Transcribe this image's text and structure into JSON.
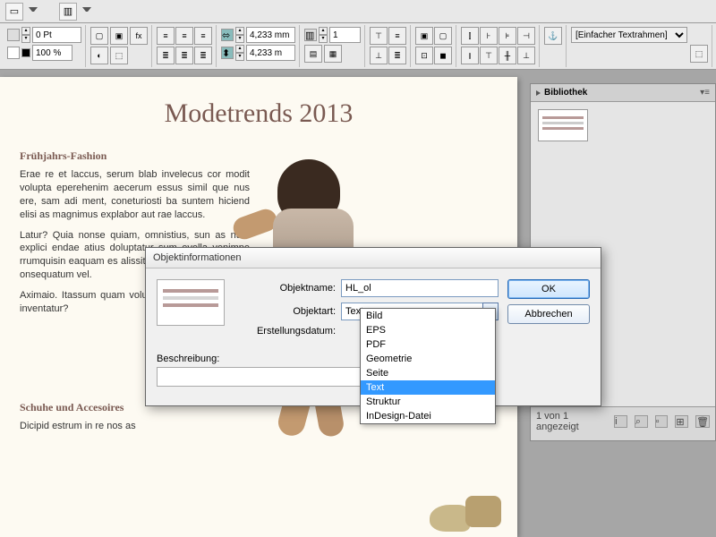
{
  "toolbar": {
    "stroke_weight": "0 Pt",
    "zoom": "100 %",
    "width": "4,233 mm",
    "height": "4,233 m",
    "cols_input": "1",
    "frame_type": "[Einfacher Textrahmen]"
  },
  "document": {
    "title": "Modetrends 2013",
    "section1_heading": "Frühjahrs-Fashion",
    "para1": "Erae re et laccus, serum blab invelecus cor modit volupta eperehenim aecerum essus simil que nus ere, sam adi ment, coneturiosti ba suntem hiciend elisi as magnimus explabor aut rae laccus.",
    "para2": "Latur? Quia nonse quiam, omnistius, sun as num explici endae atius doluptatur sum evella venimpe rrumquisin eaquam es alissit atquam as iunt, aperati onsequatum vel.",
    "para3": "Aximaio. Itassum quam volum et vollacc aborerchil inventatur?",
    "section2_heading": "Schuhe und Accesoires",
    "para4": "Dicipid estrum in re nos as"
  },
  "panel": {
    "title": "Bibliothek",
    "status": "1 von 1 angezeigt"
  },
  "dialog": {
    "title": "Objektinformationen",
    "label_name": "Objektname:",
    "value_name": "HL_ol",
    "label_type": "Objektart:",
    "value_type": "Text",
    "label_date": "Erstellungsdatum:",
    "label_desc": "Beschreibung:",
    "btn_ok": "OK",
    "btn_cancel": "Abbrechen",
    "options": [
      "Bild",
      "EPS",
      "PDF",
      "Geometrie",
      "Seite",
      "Text",
      "Struktur",
      "InDesign-Datei"
    ],
    "selected_option": "Text"
  }
}
